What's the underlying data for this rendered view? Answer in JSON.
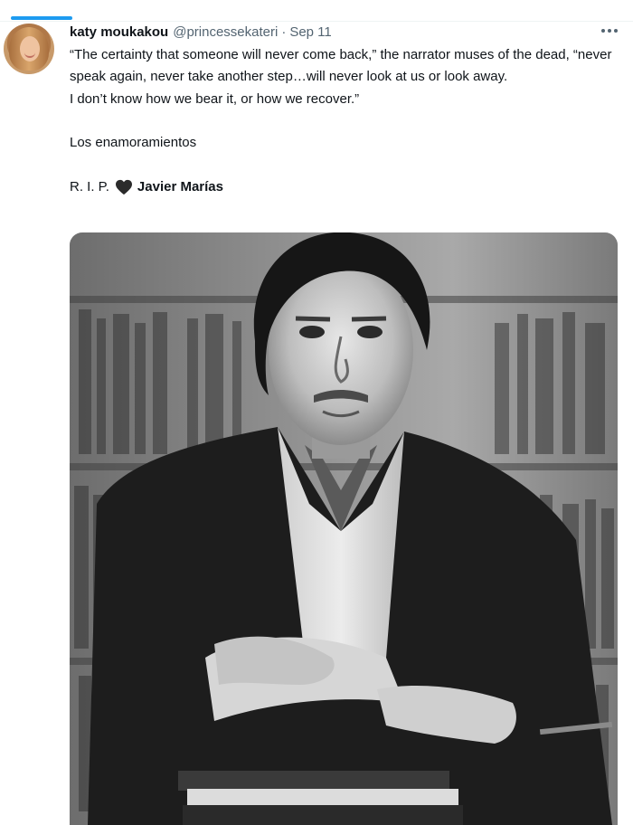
{
  "timeline": {
    "active_tab_color": "#1d9bf0"
  },
  "tweet": {
    "author_name": "katy moukakou",
    "handle": "@princessekateri",
    "separator": "·",
    "date": "Sep 11",
    "more_icon": "more-horizontal-icon",
    "text_lines": [
      "“The certainty that someone will never come back,” the narrator muses of the dead, “never speak again, never take another step…will never look at us or look away.",
      "I don’t know how we bear it, or how we recover.”",
      "Los enamoramientos"
    ],
    "rip_prefix": "R. I. P.",
    "rip_icon": "black-heart-icon",
    "rip_name": "Javier Marías",
    "media": {
      "type": "photo",
      "description_icon": "portrait-photo"
    }
  }
}
